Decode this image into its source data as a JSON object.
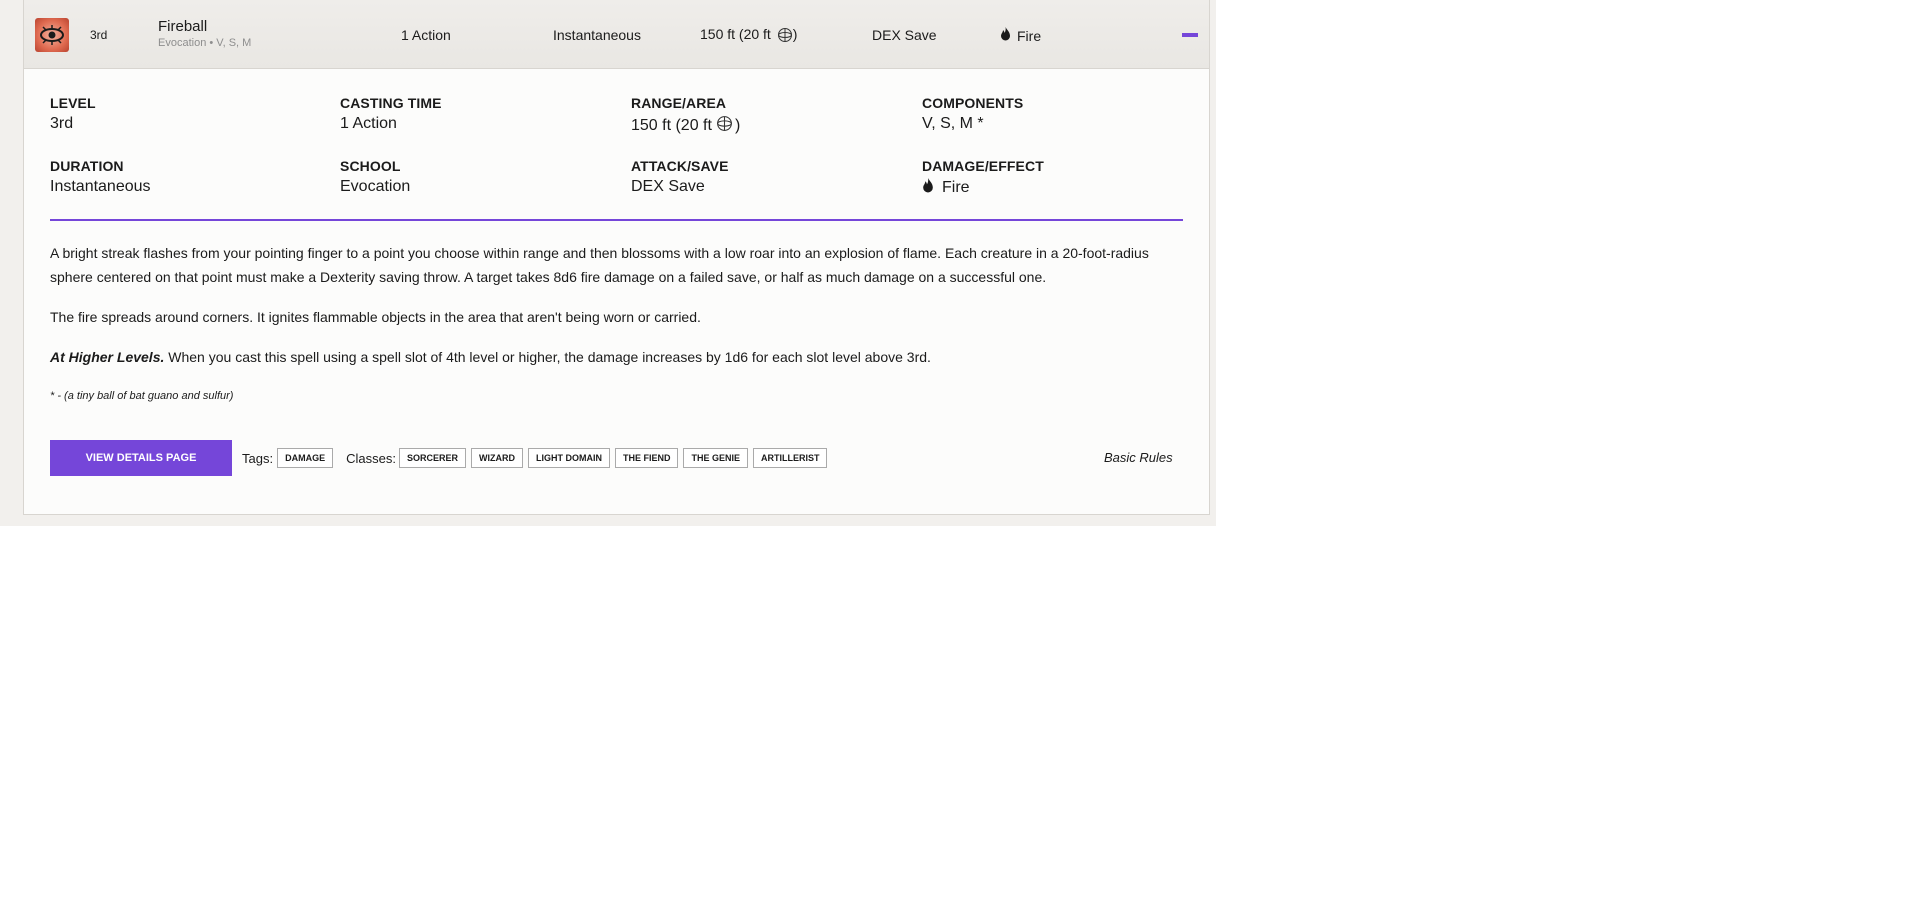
{
  "spell": {
    "name": "Fireball",
    "level": "3rd",
    "subtitle": "Evocation • V, S, M",
    "casting_time": "1 Action",
    "duration": "Instantaneous",
    "range": "150 ft (20 ft",
    "range_close": ")",
    "attack_save": "DEX Save",
    "damage": "Fire",
    "icon": "fireball-eye-icon",
    "accent_color": "#7546d9"
  },
  "stats": {
    "level": {
      "label": "LEVEL",
      "value": "3rd"
    },
    "casting_time": {
      "label": "CASTING TIME",
      "value": "1 Action"
    },
    "range": {
      "label": "RANGE/AREA",
      "value": "150 ft (20 ft",
      "close": ")"
    },
    "components": {
      "label": "COMPONENTS",
      "value": "V, S, M *"
    },
    "duration": {
      "label": "DURATION",
      "value": "Instantaneous"
    },
    "school": {
      "label": "SCHOOL",
      "value": "Evocation"
    },
    "attack_save": {
      "label": "ATTACK/SAVE",
      "value": "DEX Save"
    },
    "damage": {
      "label": "DAMAGE/EFFECT",
      "value": "Fire"
    }
  },
  "description": {
    "p1": "A bright streak flashes from your pointing finger to a point you choose within range and then blossoms with a low roar into an explosion of flame. Each creature in a 20-foot-radius sphere centered on that point must make a Dexterity saving throw. A target takes 8d6 fire damage on a failed save, or half as much damage on a successful one.",
    "p2": "The fire spreads around corners. It ignites flammable objects in the area that aren't being worn or carried.",
    "higher_label": "At Higher Levels.",
    "higher_text": " When you cast this spell using a spell slot of 4th level or higher, the damage increases by 1d6 for each slot level above 3rd.",
    "material": "* - (a tiny ball of bat guano and sulfur)"
  },
  "footer": {
    "details_button": "VIEW DETAILS PAGE",
    "tags_label": "Tags:",
    "tags": [
      "DAMAGE"
    ],
    "classes_label": "Classes:",
    "classes": [
      "SORCERER",
      "WIZARD",
      "LIGHT DOMAIN",
      "THE FIEND",
      "THE GENIE",
      "ARTILLERIST"
    ],
    "source": "Basic Rules"
  }
}
